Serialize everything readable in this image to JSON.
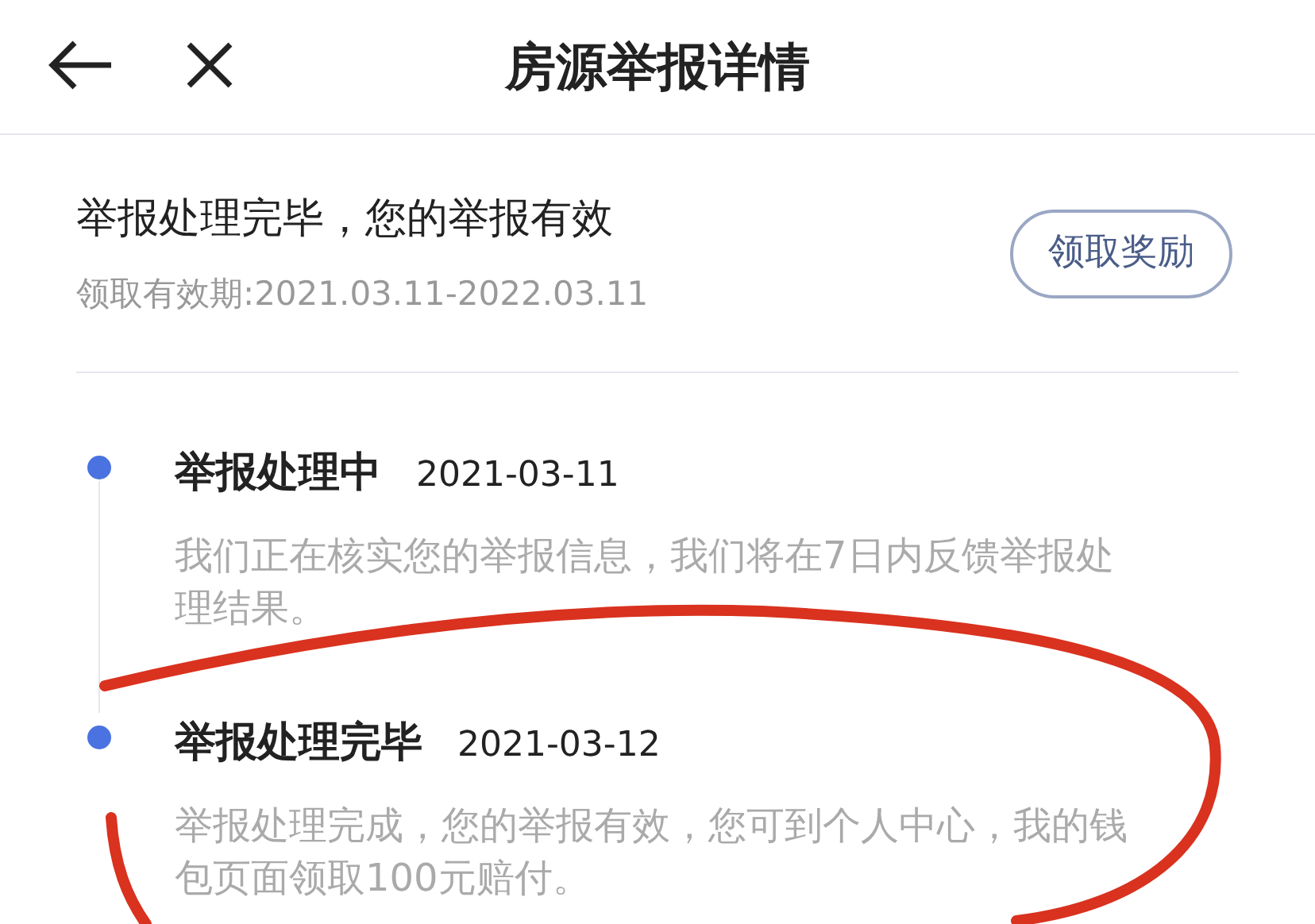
{
  "header": {
    "title": "房源举报详情"
  },
  "result": {
    "message": "举报处理完毕，您的举报有效",
    "validity": "领取有效期:2021.03.11-2022.03.11",
    "button": "领取奖励"
  },
  "timeline": [
    {
      "title": "举报处理中",
      "date": "2021-03-11",
      "description": "我们正在核实您的举报信息，我们将在7日内反馈举报处理结果。"
    },
    {
      "title": "举报处理完毕",
      "date": "2021-03-12",
      "description": "举报处理完成，您的举报有效，您可到个人中心，我的钱包页面领取100元赔付。"
    }
  ]
}
